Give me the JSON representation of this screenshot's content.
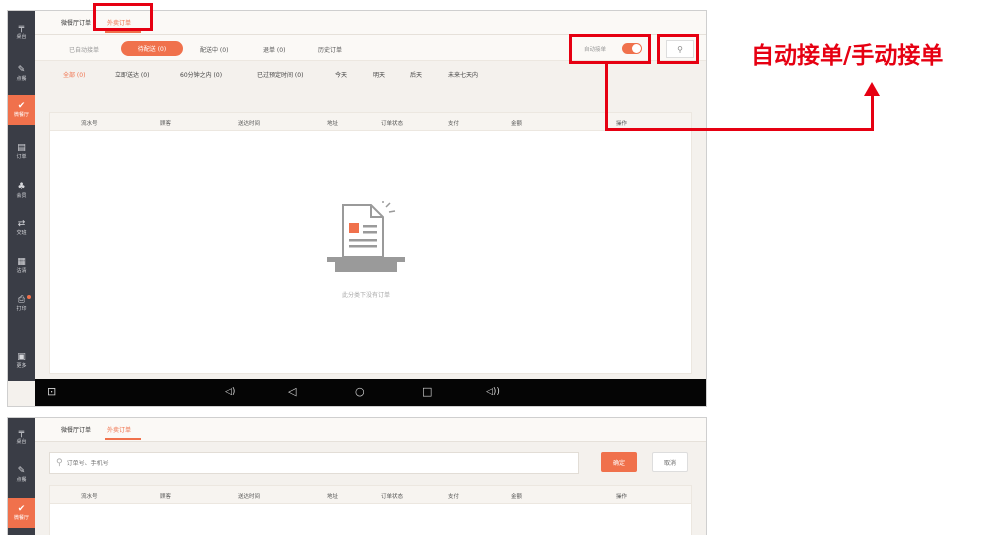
{
  "sidebar": {
    "items": [
      {
        "label": "桌台",
        "icon": "table-icon",
        "glyph": "╤"
      },
      {
        "label": "点餐",
        "icon": "order-food-icon",
        "glyph": "✎"
      },
      {
        "label": "微餐厅",
        "icon": "wechat-restaurant-icon",
        "glyph": "✔"
      },
      {
        "label": "订单",
        "icon": "orders-icon",
        "glyph": "▤"
      },
      {
        "label": "会员",
        "icon": "member-icon",
        "glyph": "♣"
      },
      {
        "label": "交班",
        "icon": "handover-icon",
        "glyph": "⇄"
      },
      {
        "label": "沽清",
        "icon": "sold-out-icon",
        "glyph": "▦"
      },
      {
        "label": "打印",
        "icon": "printer-icon",
        "glyph": "⎙"
      },
      {
        "label": "更多",
        "icon": "more-icon",
        "glyph": "▣"
      }
    ]
  },
  "top_tabs": {
    "tab1": "微餐厅订单",
    "tab2": "外卖订单"
  },
  "status_tabs": {
    "auto": "已自动接单",
    "pending": "待配送 (0)",
    "delivering": "配送中 (0)",
    "refund": "退单 (0)",
    "history": "历史订单"
  },
  "auto_accept": {
    "label": "自动接单",
    "enabled": true
  },
  "filters": [
    "全部 (0)",
    "立即送达 (0)",
    "60分钟之内 (0)",
    "已过预定时间 (0)",
    "今天",
    "明天",
    "后天",
    "未来七天内"
  ],
  "table": {
    "columns": [
      "流水号",
      "顾客",
      "送达时间",
      "地址",
      "订单状态",
      "支付",
      "金额",
      "操作"
    ],
    "empty_text": "此分类下没有订单"
  },
  "android_nav": {
    "screenshot": "⊡",
    "vol_down": "◁)",
    "back": "◁",
    "home": "○",
    "recent": "□",
    "vol_up": "◁))"
  },
  "search_screen": {
    "placeholder": "订单号、手机号",
    "confirm": "确定",
    "cancel": "取消"
  },
  "annotation": {
    "text": "自动接单/手动接单",
    "color": "#e60012"
  },
  "colors": {
    "accent": "#f0714c",
    "sidebar": "#3a3d46",
    "annotation": "#e60012"
  }
}
